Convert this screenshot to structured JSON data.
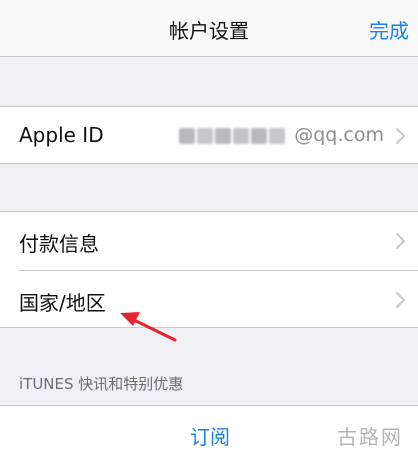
{
  "navbar": {
    "title": "帐户设置",
    "done_label": "完成"
  },
  "account_group": {
    "apple_id_label": "Apple ID",
    "apple_id_value": "@qq.com"
  },
  "settings_group": {
    "items": [
      {
        "label": "付款信息"
      },
      {
        "label": "国家/地区"
      }
    ]
  },
  "itunes_section": {
    "footer": "iTUNES 快讯和特别优惠"
  },
  "bottom": {
    "subscribe_label": "订阅"
  },
  "watermark": "古路网",
  "icons": {
    "chevron": "chevron-right-icon",
    "annotation": "red-arrow-annotation"
  },
  "colors": {
    "accent": "#1a82e6",
    "background": "#efeff4",
    "annotation": "#e8232d"
  }
}
